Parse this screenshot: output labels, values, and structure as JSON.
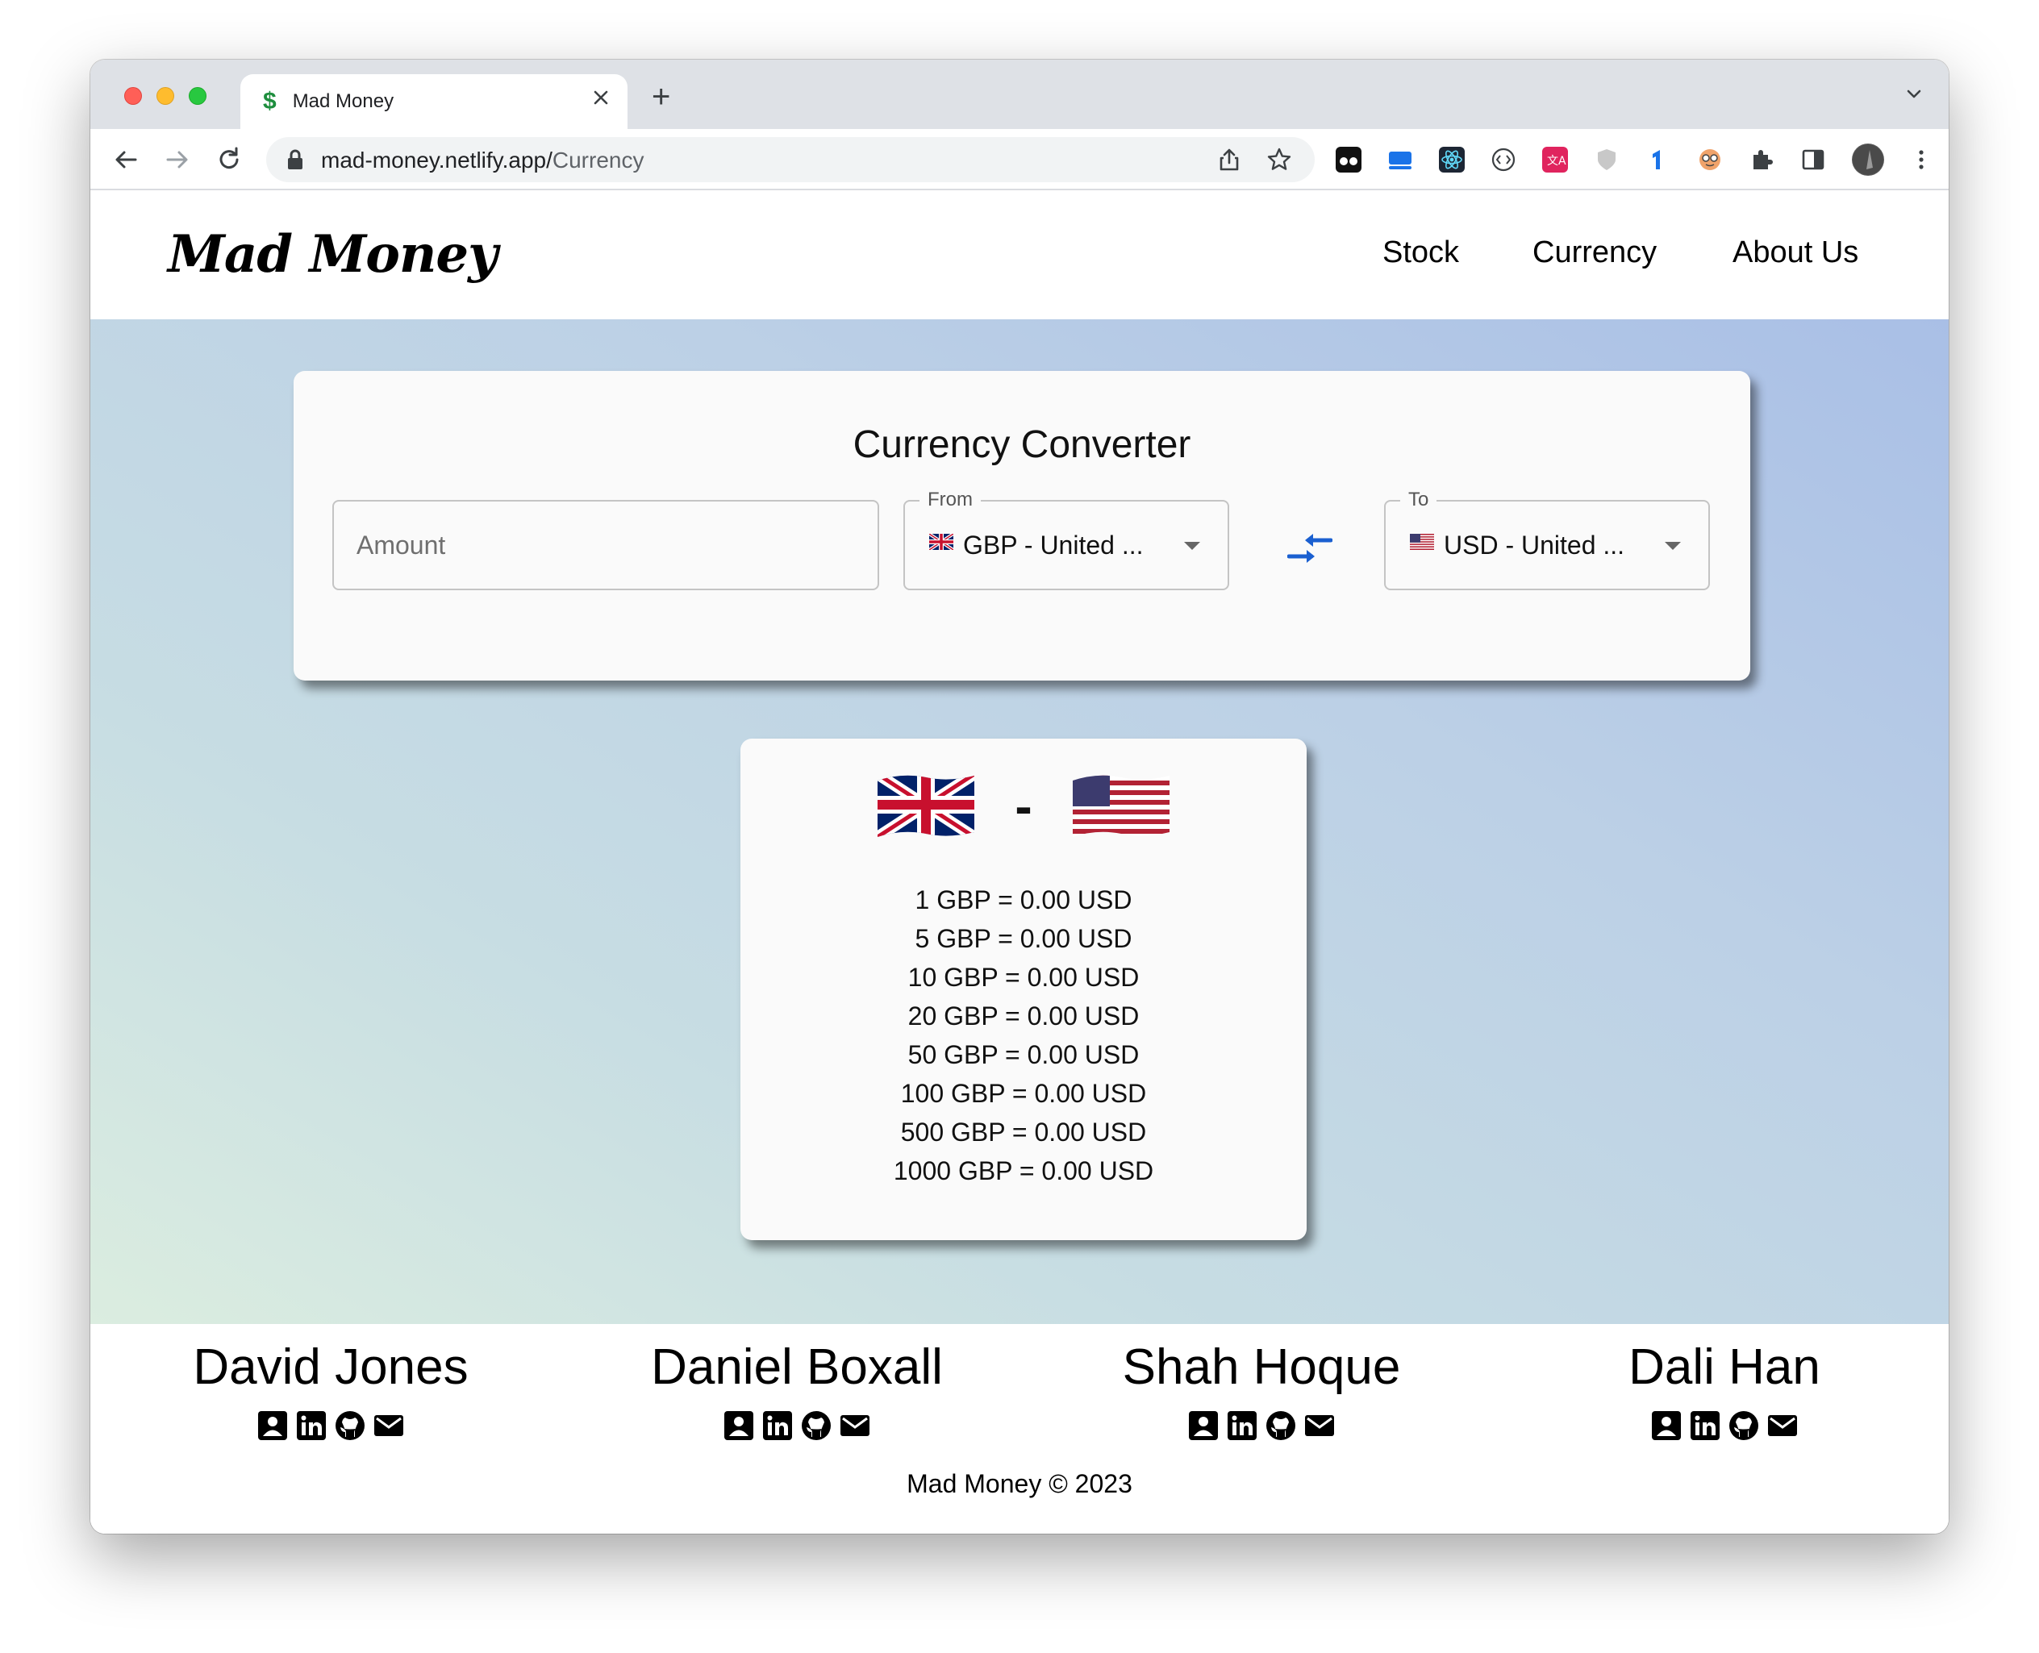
{
  "browser": {
    "tab_favicon": "$",
    "tab_title": "Mad Money",
    "new_tab": "+",
    "url_host": "mad-money.netlify.app/",
    "url_path": "Currency"
  },
  "navbar": {
    "logo": "Mad Money",
    "links": [
      "Stock",
      "Currency",
      "About Us"
    ]
  },
  "converter": {
    "title": "Currency Converter",
    "amount_placeholder": "Amount",
    "from_label": "From",
    "from_value": "GBP - United ...",
    "to_label": "To",
    "to_value": "USD - United ..."
  },
  "rates": {
    "separator": "-",
    "lines": [
      "1 GBP = 0.00 USD",
      "5 GBP = 0.00 USD",
      "10 GBP = 0.00 USD",
      "20 GBP = 0.00 USD",
      "50 GBP = 0.00 USD",
      "100 GBP = 0.00 USD",
      "500 GBP = 0.00 USD",
      "1000 GBP = 0.00 USD"
    ]
  },
  "footer": {
    "members": [
      "David Jones",
      "Daniel Boxall",
      "Shah Hoque",
      "Dali Han"
    ],
    "copyright": "Mad Money © 2023"
  },
  "colors": {
    "accent_blue": "#1a5fd0",
    "traffic_red": "#ff5f57",
    "traffic_yellow": "#febc2e",
    "traffic_green": "#28c840"
  }
}
